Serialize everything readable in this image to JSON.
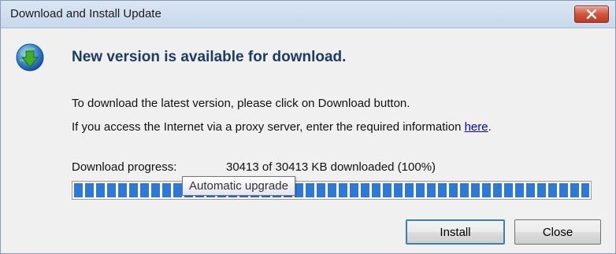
{
  "window": {
    "title": "Download and Install Update"
  },
  "header": {
    "headline": "New version is available for download.",
    "icon": "globe-download-icon"
  },
  "body": {
    "instruction": "To download the latest version, please click on Download button.",
    "proxy_text": "If you access the Internet via a proxy server, enter the required information",
    "proxy_link": "here",
    "proxy_suffix": "."
  },
  "progress": {
    "label": "Download progress:",
    "status": "30413 of 30413 KB downloaded (100%)",
    "percent": 100,
    "tooltip": "Automatic upgrade"
  },
  "buttons": {
    "install": "Install",
    "close": "Close"
  },
  "colors": {
    "progress": "#2f79d6",
    "headline": "#1c3b66",
    "close_button": "#c23a1f"
  }
}
